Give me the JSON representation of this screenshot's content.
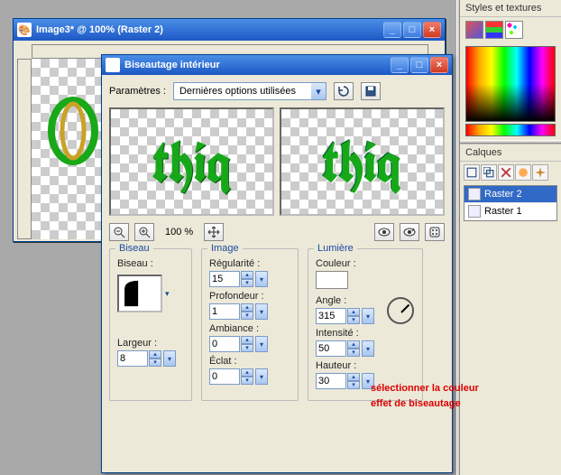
{
  "image_window": {
    "title": "Image3* @ 100% (Raster 2)"
  },
  "dialog": {
    "title": "Biseautage intérieur",
    "parametres_label": "Paramètres :",
    "parametres_value": "Dernières options utilisées",
    "zoom_label": "100 %",
    "preview_text": "thiq",
    "groups": {
      "biseau": {
        "title": "Biseau",
        "biseau_label": "Biseau :",
        "largeur_label": "Largeur :",
        "largeur_value": "8"
      },
      "image": {
        "title": "Image",
        "regularite_label": "Régularité :",
        "regularite_value": "15",
        "profondeur_label": "Profondeur :",
        "profondeur_value": "1",
        "ambiance_label": "Ambiance :",
        "ambiance_value": "0",
        "eclat_label": "Éclat :",
        "eclat_value": "0"
      },
      "lumiere": {
        "title": "Lumière",
        "couleur_label": "Couleur :",
        "couleur_value": "#ffffff",
        "angle_label": "Angle :",
        "angle_value": "315",
        "intensite_label": "Intensité :",
        "intensite_value": "50",
        "hauteur_label": "Hauteur :",
        "hauteur_value": "30"
      }
    }
  },
  "right": {
    "styles_title": "Styles et textures",
    "calques_title": "Calques",
    "layers": [
      "Raster 2",
      "Raster 1"
    ]
  },
  "annotation": {
    "line1": "sélectionner la couleur",
    "line2": "effet de biseautage"
  }
}
